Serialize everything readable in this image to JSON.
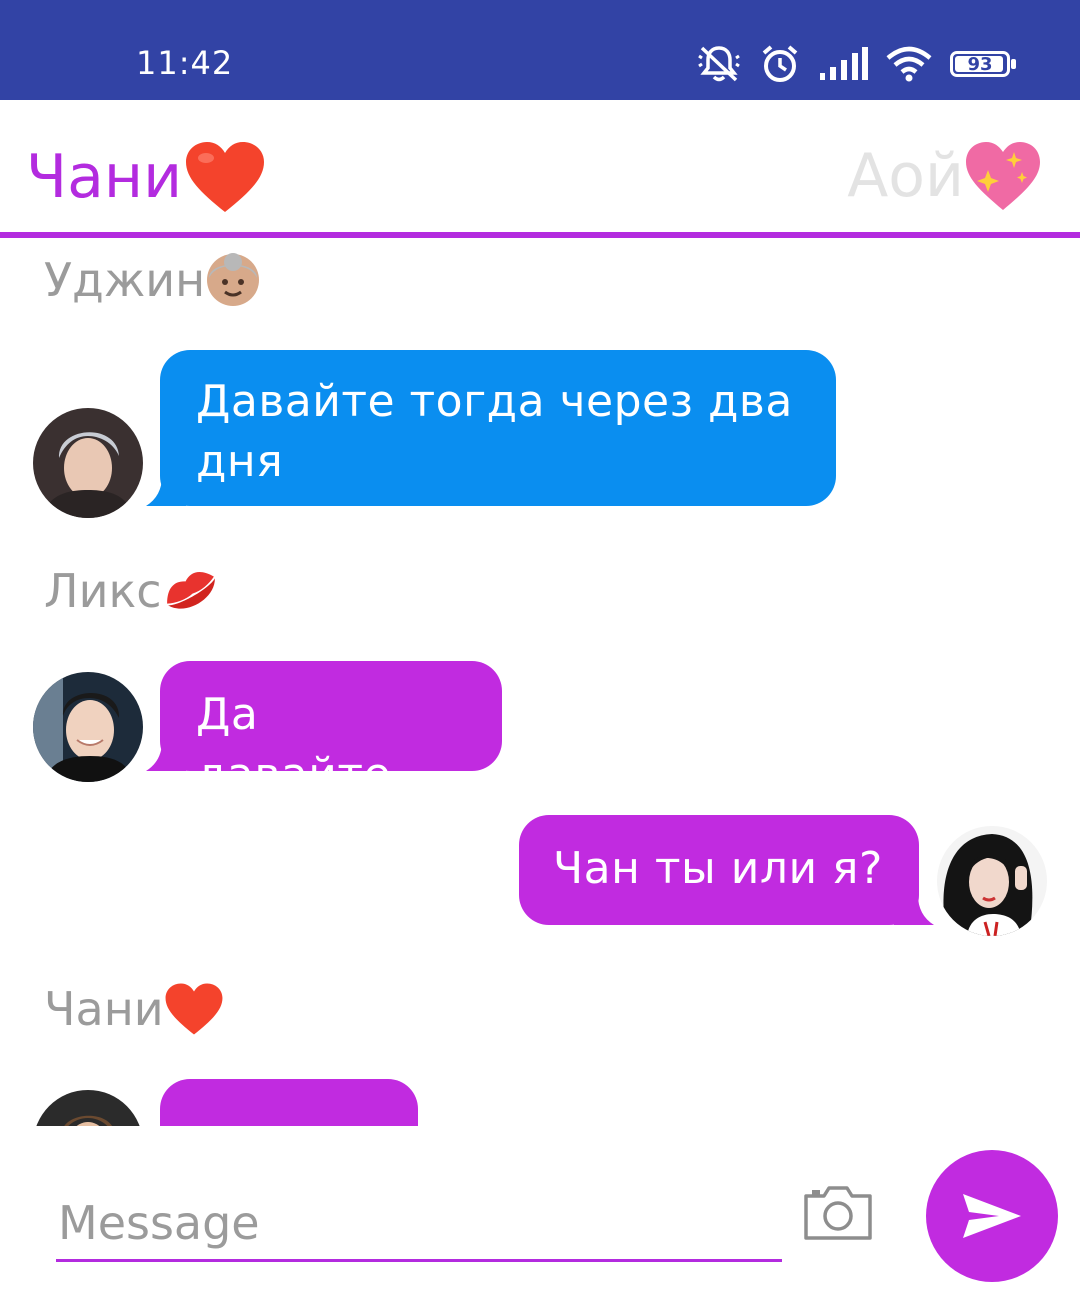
{
  "status_bar": {
    "time": "11:42",
    "battery": "93"
  },
  "header": {
    "left_tab": "Чани",
    "right_tab": "Аой"
  },
  "messages": [
    {
      "sender": "Уджин",
      "text": "Давайте тогда через два дня",
      "side": "left",
      "color": "#0a8ef0"
    },
    {
      "sender": "Ликс",
      "text": "Да давайте",
      "side": "left",
      "color": "#c12be0"
    },
    {
      "sender": "",
      "text": "Чан ты или я?",
      "side": "right",
      "color": "#c12be0"
    },
    {
      "sender": "Чани",
      "text": "",
      "side": "left",
      "color": "#c12be0"
    }
  ],
  "input": {
    "placeholder": "Message"
  },
  "colors": {
    "accent": "#b32bdf",
    "status_bar": "#3243a5",
    "blue_bubble": "#0a8ef0",
    "purple_bubble": "#c12be0"
  },
  "icons": [
    "muted-bell-icon",
    "alarm-icon",
    "signal-icon",
    "wifi-icon",
    "battery-icon",
    "red-heart-emoji",
    "sparkling-heart-emoji",
    "older-person-emoji",
    "kiss-mark-emoji",
    "camera-icon",
    "send-icon"
  ]
}
